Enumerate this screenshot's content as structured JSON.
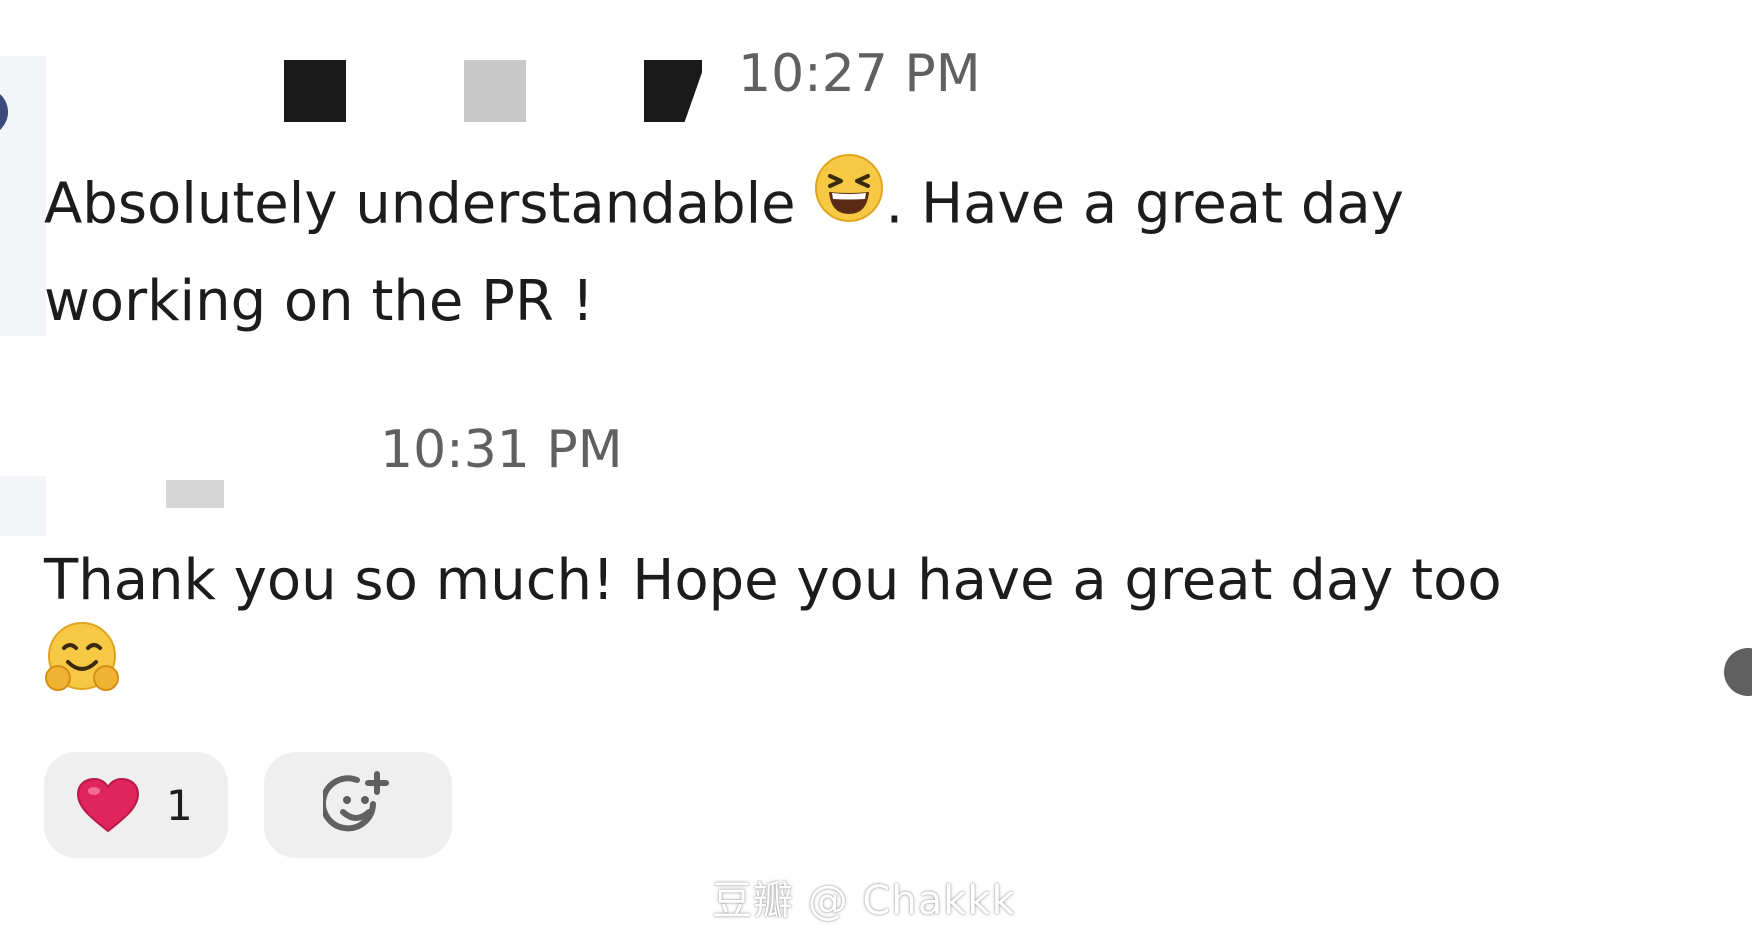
{
  "messages": [
    {
      "timestamp": "10:27 PM",
      "text_before_emoji": "Absolutely understandable ",
      "emoji": "laughing-face-icon",
      "text_after_emoji": ". Have a great day working on the PR !"
    },
    {
      "timestamp": "10:31 PM",
      "text_before_emoji": "Thank you so much! Hope you have a great day too ",
      "emoji": "hugging-face-icon",
      "reactions": [
        {
          "emoji": "red-heart-icon",
          "count": "1"
        }
      ],
      "add_reaction_icon": "add-reaction-icon"
    }
  ],
  "watermark": "豆瓣 @ Chakkk",
  "colors": {
    "text": "#1d1c1d",
    "timestamp": "#616061",
    "reaction_bg": "#efefef",
    "heart": "#e0245e"
  }
}
